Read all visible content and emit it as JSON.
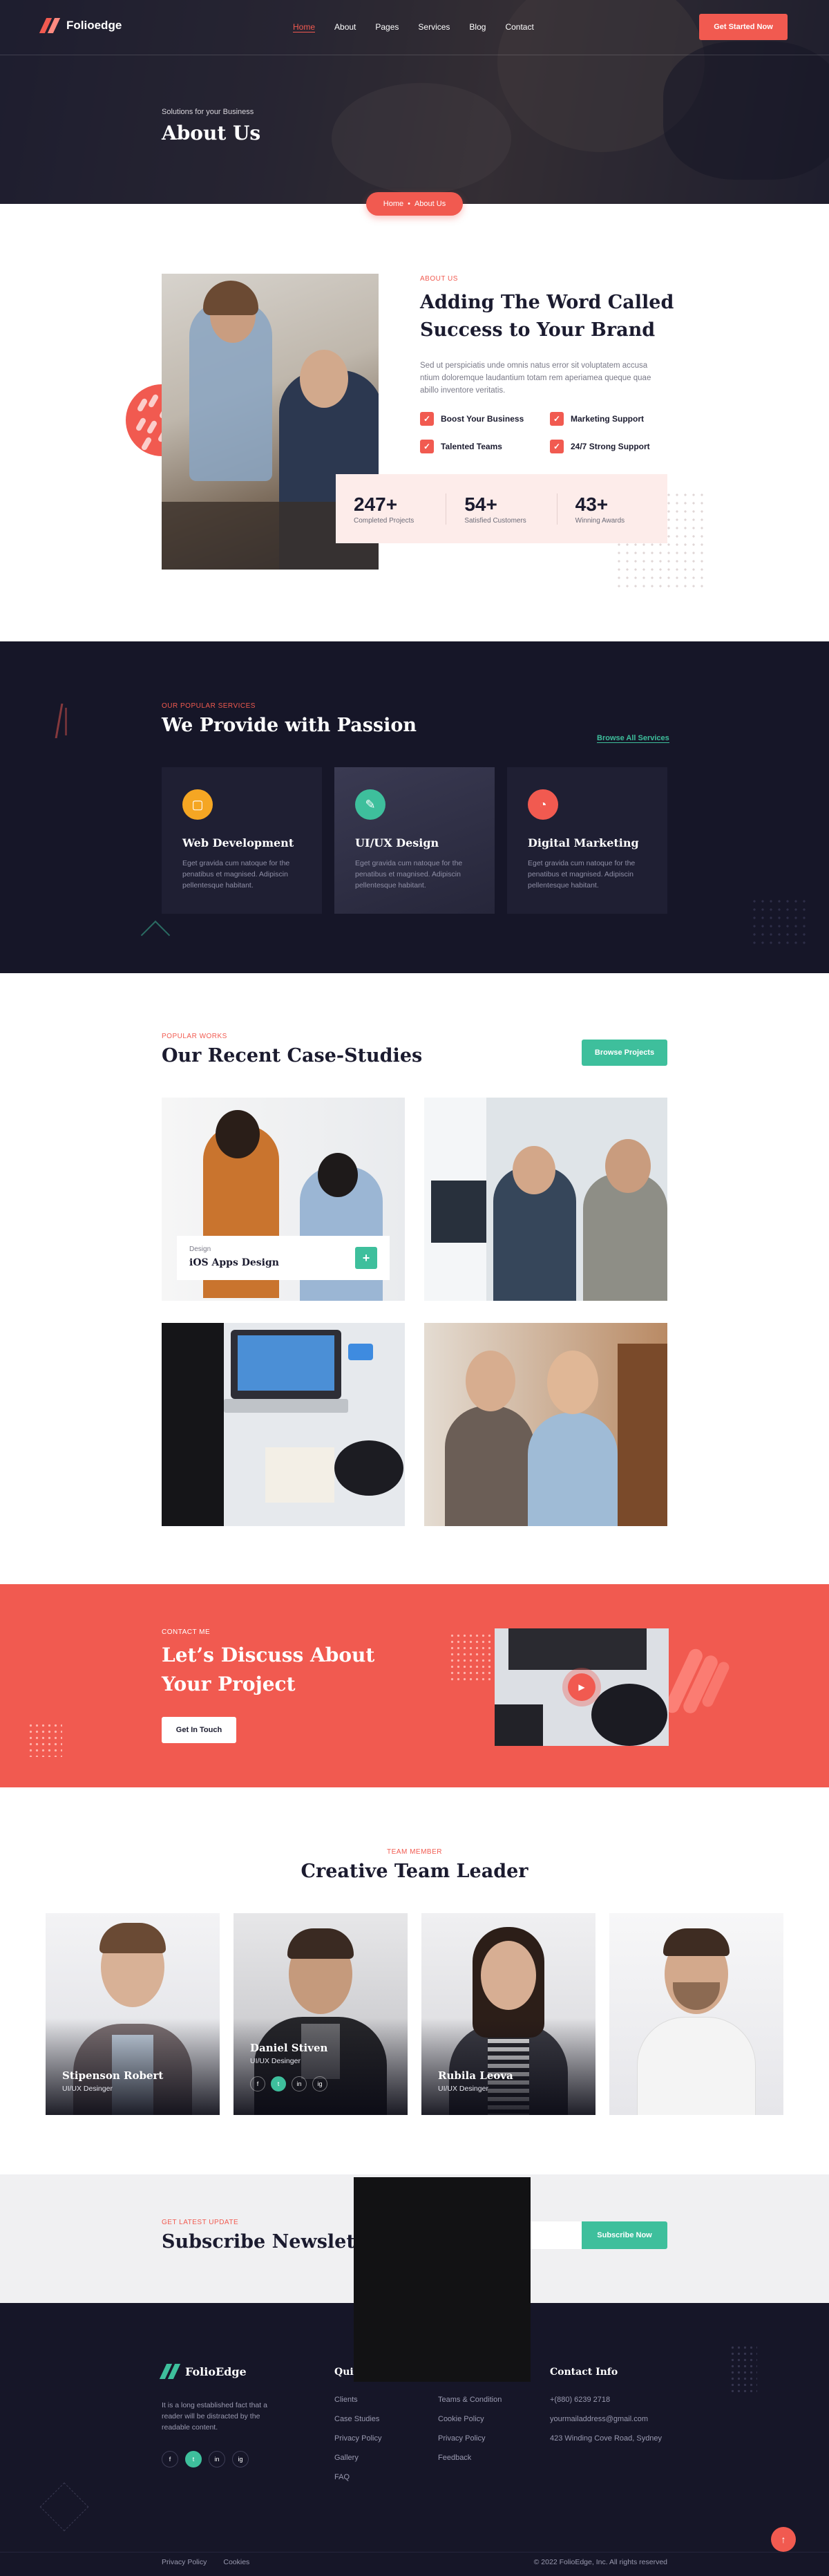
{
  "brand": {
    "name": "Folioedge",
    "accent": "#f15a50",
    "teal": "#3ebf9c",
    "dark": "#161628"
  },
  "nav": {
    "items": [
      {
        "label": "Home",
        "active": true
      },
      {
        "label": "About",
        "active": false
      },
      {
        "label": "Pages",
        "active": false
      },
      {
        "label": "Services",
        "active": false
      },
      {
        "label": "Blog",
        "active": false
      },
      {
        "label": "Contact",
        "active": false
      }
    ],
    "cta": "Get Started Now"
  },
  "hero": {
    "subtitle": "Solutions for your Business",
    "title": "About Us"
  },
  "breadcrumb": {
    "home": "Home",
    "separator": "•",
    "current": "About Us"
  },
  "about": {
    "label": "ABOUT US",
    "title_line1": "Adding The Word Called",
    "title_line2": "Success to Your Brand",
    "text": "Sed ut perspiciatis unde omnis natus error sit voluptatem accusa ntium doloremque laudantium totam rem aperiamea queque quae abillo inventore veritatis.",
    "features": [
      "Boost Your Business",
      "Marketing Support",
      "Talented Teams",
      "24/7 Strong Support"
    ],
    "stats": [
      {
        "number": "247+",
        "label": "Completed Projects"
      },
      {
        "number": "54+",
        "label": "Satisfied Customers"
      },
      {
        "number": "43+",
        "label": "Winning Awards"
      }
    ]
  },
  "services": {
    "label": "OUR POPULAR SERVICES",
    "title": "We Provide with Passion",
    "browse": "Browse All Services",
    "cards": [
      {
        "title": "Web Development",
        "text": "Eget gravida cum natoque for the penatibus et magnised. Adipiscin pellentesque habitant.",
        "icon": "browser-icon",
        "color": "#f5a623"
      },
      {
        "title": "UI/UX Design",
        "text": "Eget gravida cum natoque for the penatibus et magnised. Adipiscin pellentesque habitant.",
        "icon": "pen-tool-icon",
        "color": "#3ebf9c"
      },
      {
        "title": "Digital Marketing",
        "text": "Eget gravida cum natoque for the penatibus et magnised. Adipiscin pellentesque habitant.",
        "icon": "chart-icon",
        "color": "#f15a50"
      }
    ]
  },
  "cases": {
    "label": "POPULAR WORKS",
    "title": "Our Recent Case-Studies",
    "browse": "Browse Projects",
    "featured": {
      "category": "Design",
      "title": "iOS Apps Design",
      "plus": "+"
    }
  },
  "contact": {
    "label": "CONTACT ME",
    "title_line1": "Let’s Discuss About",
    "title_line2": "Your Project",
    "button": "Get In Touch"
  },
  "team": {
    "label": "TEAM MEMBER",
    "title": "Creative Team Leader",
    "members": [
      {
        "name": "Stipenson Robert",
        "role": "UI/UX Desinger"
      },
      {
        "name": "Daniel Stiven",
        "role": "UI/UX Desinger"
      },
      {
        "name": "Rubila Leova",
        "role": "UI/UX Desinger"
      }
    ],
    "social": [
      "f",
      "t",
      "in",
      "ig"
    ]
  },
  "subscribe": {
    "label": "GET LATEST UPDATE",
    "title": "Subscribe Newsletter",
    "button": "Subscribe Now"
  },
  "footer": {
    "brand": "FolioEdge",
    "about": "It is a long established fact that a reader will be distracted by the readable content.",
    "quick_title": "Quick Links",
    "col1": [
      "Clients",
      "Case Studies",
      "Privacy Policy",
      "Gallery",
      "FAQ"
    ],
    "col2": [
      "Teams & Condition",
      "Cookie Policy",
      "Privacy Policy",
      "Feedback"
    ],
    "contact_title": "Contact Info",
    "contact": [
      "+(880) 6239 2718",
      "yourmailaddress@gmail.com",
      "423 Winding Cove Road, Sydney"
    ],
    "bottom_links": [
      "Privacy Policy",
      "Cookies"
    ],
    "copyright": "© 2022 FolioEdge, Inc. All rights reserved"
  }
}
